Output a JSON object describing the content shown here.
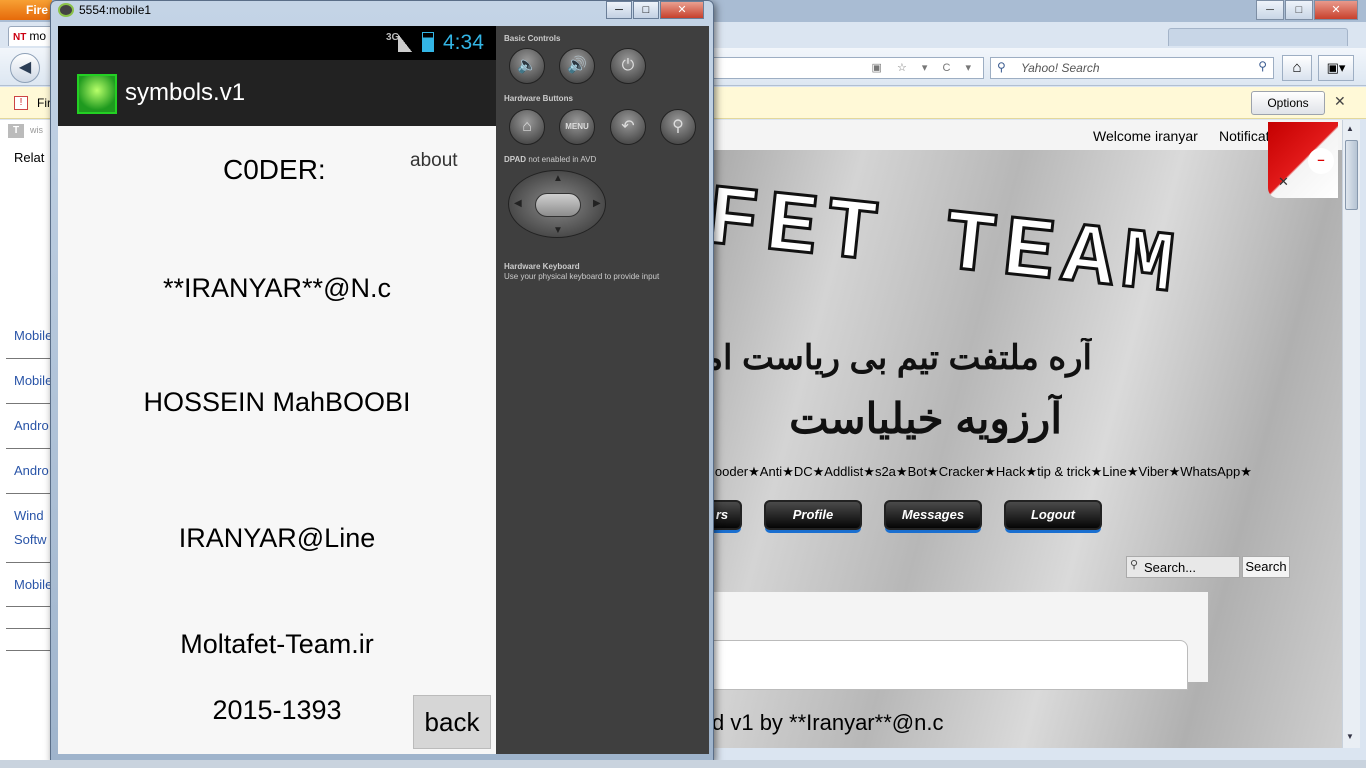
{
  "browser": {
    "menu_label": "Fire",
    "tab_label": "mo",
    "tab_favicon": "NT",
    "controls": [
      "─",
      "□",
      "✕"
    ],
    "back_icon": "◀",
    "url_icons": "▣ ☆ ▾ C ▾",
    "search_placeholder": "Yahoo! Search",
    "search_icon": "⚲",
    "search_go": "⚲",
    "home_icon": "⌂",
    "bookmark_icon": "▣▾",
    "notification_text": "Fir",
    "notification_options": "Options",
    "notification_close": "✕"
  },
  "left_pane": {
    "logo": "T",
    "logo_text": "wis",
    "related": "Relat",
    "links": [
      "Mobile",
      "Mobile",
      "Andro",
      "Andro",
      "Wind",
      "Softw",
      "Mobile"
    ]
  },
  "site": {
    "welcome": "Welcome iranyar",
    "notifications": "Notificati",
    "title": "FET TEAM",
    "persian_line1": "آره ملتفت تیم بی ریاست اما",
    "persian_line2": "آرزویه خیلیاست",
    "tags": "looder★Anti★DC★Addlist★s2a★Bot★Cracker★Hack★tip & trick★Line★Viber★WhatsApp★",
    "nav": [
      "rs",
      "Profile",
      "Messages",
      "Logout"
    ],
    "search_placeholder": "Search...",
    "search_button": "Search",
    "footer": "d v1 by **Iranyar**@n.c",
    "curl_close": "✕"
  },
  "emulator": {
    "window_title": "5554:mobile1",
    "controls": [
      "─",
      "□",
      "✕"
    ],
    "status": {
      "network": "3G",
      "time": "4:34"
    },
    "app_title": "symbols.v1",
    "coder_label": "C0DER:",
    "about": "about",
    "lines": [
      "**IRANYAR**@N.c",
      "HOSSEIN MahBOOBI",
      "IRANYAR@Line",
      "Moltafet-Team.ir",
      "2015-1393"
    ],
    "back": "back",
    "panel": {
      "basic_controls": "Basic Controls",
      "hardware_buttons": "Hardware Buttons",
      "dpad": "DPAD",
      "dpad_note": "not enabled in AVD",
      "keyboard_title": "Hardware Keyboard",
      "keyboard_desc": "Use your physical keyboard to provide input",
      "menu": "MENU",
      "icons": {
        "vol_down": "🔈",
        "vol_up": "🔊",
        "power": "⏻",
        "home": "⌂",
        "back": "↶",
        "search": "⚲"
      }
    }
  },
  "colors": {
    "accent_blue": "#33b5e5",
    "action_bar": "#222222",
    "panel": "#3f3f3f"
  }
}
